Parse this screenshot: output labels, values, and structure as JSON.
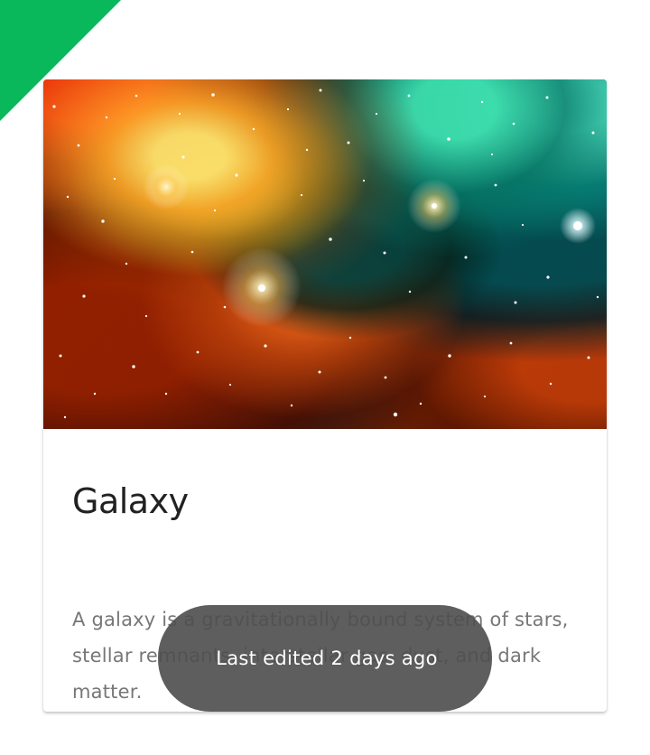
{
  "card": {
    "image_alt": "Galaxy",
    "title": "Galaxy",
    "description": "A galaxy is a gravitationally bound system of stars, stellar remnants, interstellar gas, dust, and dark matter."
  },
  "snackbar": {
    "message": "Last edited 2 days ago"
  },
  "colors": {
    "accent": "#09b85b",
    "snackbar_background": "#4e4e4e",
    "title": "#212121",
    "body_text": "#777777"
  }
}
